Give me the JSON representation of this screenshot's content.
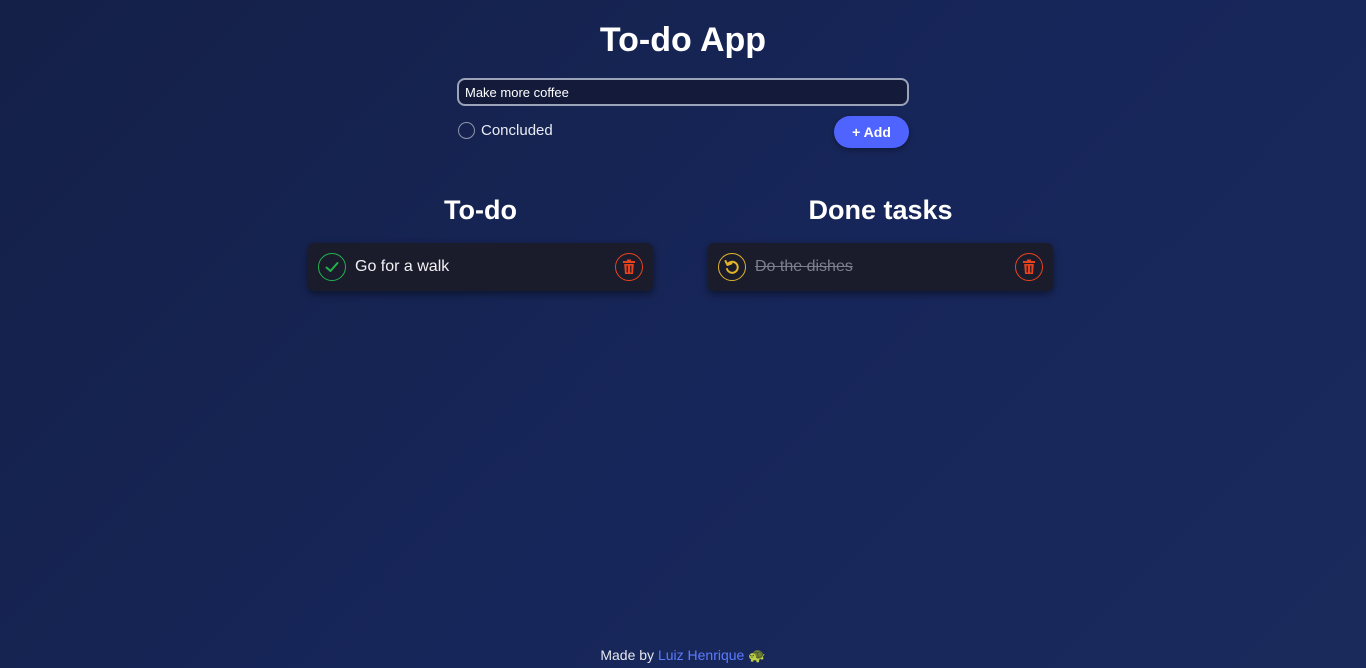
{
  "app": {
    "title": "To-do App"
  },
  "form": {
    "input_value": "Make more coffee",
    "concluded_label": "Concluded",
    "add_label": "+ Add"
  },
  "todo": {
    "title": "To-do",
    "tasks": [
      {
        "text": "Go for a walk",
        "status_icon": "check-icon",
        "delete_icon": "trash-icon"
      }
    ]
  },
  "done": {
    "title": "Done tasks",
    "tasks": [
      {
        "text": "Do the dishes",
        "status_icon": "undo-icon",
        "delete_icon": "trash-icon"
      }
    ]
  },
  "footer": {
    "prefix": "Made by",
    "author": "Luiz Henrique",
    "emoji": "🐢"
  },
  "colors": {
    "accent": "#4f63ff",
    "complete": "#22b24c",
    "undo": "#e0b32a",
    "delete": "#e8421d",
    "link": "#5b7bff"
  }
}
